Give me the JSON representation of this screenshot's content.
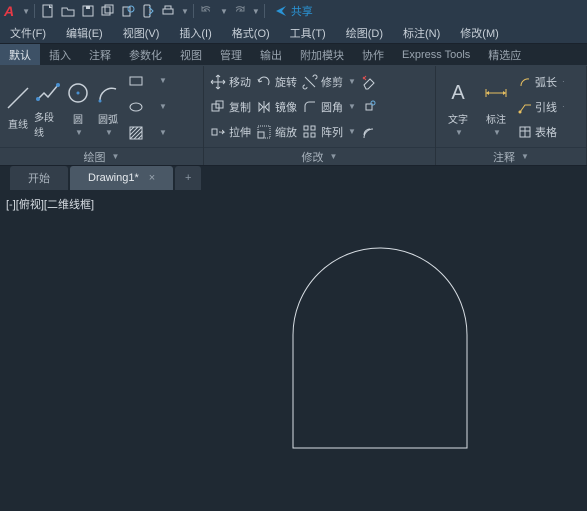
{
  "app": {
    "logo": "A",
    "share": "共享"
  },
  "menubar": {
    "items": [
      "文件(F)",
      "编辑(E)",
      "视图(V)",
      "插入(I)",
      "格式(O)",
      "工具(T)",
      "绘图(D)",
      "标注(N)",
      "修改(M)"
    ]
  },
  "ribbon": {
    "tabs": [
      "默认",
      "插入",
      "注释",
      "参数化",
      "视图",
      "管理",
      "输出",
      "附加模块",
      "协作",
      "Express Tools",
      "精选应"
    ],
    "active": 0,
    "draw": {
      "title": "绘图",
      "line": "直线",
      "polyline": "多段线",
      "circle": "圆",
      "arc": "圆弧"
    },
    "modify": {
      "title": "修改",
      "move": "移动",
      "rotate": "旋转",
      "trim": "修剪",
      "copy": "复制",
      "mirror": "镜像",
      "fillet": "圆角",
      "stretch": "拉伸",
      "scale": "缩放",
      "array": "阵列"
    },
    "annot": {
      "title": "注释",
      "text": "文字",
      "dim": "标注",
      "arclen": "弧长",
      "leader": "引线",
      "table": "表格"
    }
  },
  "tabs": {
    "start": "开始",
    "drawing": "Drawing1*"
  },
  "viewport": {
    "label": "[-][俯视][二维线框]"
  }
}
